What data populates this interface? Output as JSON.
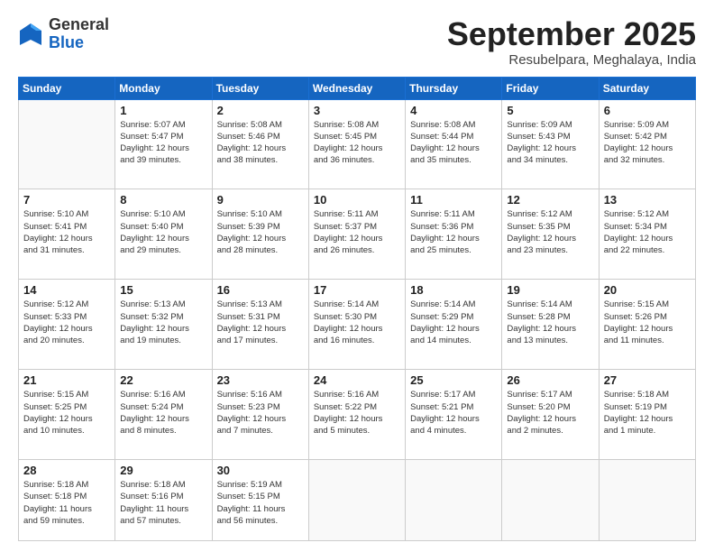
{
  "header": {
    "logo": {
      "line1": "General",
      "line2": "Blue"
    },
    "title": "September 2025",
    "location": "Resubelpara, Meghalaya, India"
  },
  "weekdays": [
    "Sunday",
    "Monday",
    "Tuesday",
    "Wednesday",
    "Thursday",
    "Friday",
    "Saturday"
  ],
  "weeks": [
    [
      {
        "day": null,
        "info": null
      },
      {
        "day": "1",
        "info": "Sunrise: 5:07 AM\nSunset: 5:47 PM\nDaylight: 12 hours\nand 39 minutes."
      },
      {
        "day": "2",
        "info": "Sunrise: 5:08 AM\nSunset: 5:46 PM\nDaylight: 12 hours\nand 38 minutes."
      },
      {
        "day": "3",
        "info": "Sunrise: 5:08 AM\nSunset: 5:45 PM\nDaylight: 12 hours\nand 36 minutes."
      },
      {
        "day": "4",
        "info": "Sunrise: 5:08 AM\nSunset: 5:44 PM\nDaylight: 12 hours\nand 35 minutes."
      },
      {
        "day": "5",
        "info": "Sunrise: 5:09 AM\nSunset: 5:43 PM\nDaylight: 12 hours\nand 34 minutes."
      },
      {
        "day": "6",
        "info": "Sunrise: 5:09 AM\nSunset: 5:42 PM\nDaylight: 12 hours\nand 32 minutes."
      }
    ],
    [
      {
        "day": "7",
        "info": "Sunrise: 5:10 AM\nSunset: 5:41 PM\nDaylight: 12 hours\nand 31 minutes."
      },
      {
        "day": "8",
        "info": "Sunrise: 5:10 AM\nSunset: 5:40 PM\nDaylight: 12 hours\nand 29 minutes."
      },
      {
        "day": "9",
        "info": "Sunrise: 5:10 AM\nSunset: 5:39 PM\nDaylight: 12 hours\nand 28 minutes."
      },
      {
        "day": "10",
        "info": "Sunrise: 5:11 AM\nSunset: 5:37 PM\nDaylight: 12 hours\nand 26 minutes."
      },
      {
        "day": "11",
        "info": "Sunrise: 5:11 AM\nSunset: 5:36 PM\nDaylight: 12 hours\nand 25 minutes."
      },
      {
        "day": "12",
        "info": "Sunrise: 5:12 AM\nSunset: 5:35 PM\nDaylight: 12 hours\nand 23 minutes."
      },
      {
        "day": "13",
        "info": "Sunrise: 5:12 AM\nSunset: 5:34 PM\nDaylight: 12 hours\nand 22 minutes."
      }
    ],
    [
      {
        "day": "14",
        "info": "Sunrise: 5:12 AM\nSunset: 5:33 PM\nDaylight: 12 hours\nand 20 minutes."
      },
      {
        "day": "15",
        "info": "Sunrise: 5:13 AM\nSunset: 5:32 PM\nDaylight: 12 hours\nand 19 minutes."
      },
      {
        "day": "16",
        "info": "Sunrise: 5:13 AM\nSunset: 5:31 PM\nDaylight: 12 hours\nand 17 minutes."
      },
      {
        "day": "17",
        "info": "Sunrise: 5:14 AM\nSunset: 5:30 PM\nDaylight: 12 hours\nand 16 minutes."
      },
      {
        "day": "18",
        "info": "Sunrise: 5:14 AM\nSunset: 5:29 PM\nDaylight: 12 hours\nand 14 minutes."
      },
      {
        "day": "19",
        "info": "Sunrise: 5:14 AM\nSunset: 5:28 PM\nDaylight: 12 hours\nand 13 minutes."
      },
      {
        "day": "20",
        "info": "Sunrise: 5:15 AM\nSunset: 5:26 PM\nDaylight: 12 hours\nand 11 minutes."
      }
    ],
    [
      {
        "day": "21",
        "info": "Sunrise: 5:15 AM\nSunset: 5:25 PM\nDaylight: 12 hours\nand 10 minutes."
      },
      {
        "day": "22",
        "info": "Sunrise: 5:16 AM\nSunset: 5:24 PM\nDaylight: 12 hours\nand 8 minutes."
      },
      {
        "day": "23",
        "info": "Sunrise: 5:16 AM\nSunset: 5:23 PM\nDaylight: 12 hours\nand 7 minutes."
      },
      {
        "day": "24",
        "info": "Sunrise: 5:16 AM\nSunset: 5:22 PM\nDaylight: 12 hours\nand 5 minutes."
      },
      {
        "day": "25",
        "info": "Sunrise: 5:17 AM\nSunset: 5:21 PM\nDaylight: 12 hours\nand 4 minutes."
      },
      {
        "day": "26",
        "info": "Sunrise: 5:17 AM\nSunset: 5:20 PM\nDaylight: 12 hours\nand 2 minutes."
      },
      {
        "day": "27",
        "info": "Sunrise: 5:18 AM\nSunset: 5:19 PM\nDaylight: 12 hours\nand 1 minute."
      }
    ],
    [
      {
        "day": "28",
        "info": "Sunrise: 5:18 AM\nSunset: 5:18 PM\nDaylight: 11 hours\nand 59 minutes."
      },
      {
        "day": "29",
        "info": "Sunrise: 5:18 AM\nSunset: 5:16 PM\nDaylight: 11 hours\nand 57 minutes."
      },
      {
        "day": "30",
        "info": "Sunrise: 5:19 AM\nSunset: 5:15 PM\nDaylight: 11 hours\nand 56 minutes."
      },
      {
        "day": null,
        "info": null
      },
      {
        "day": null,
        "info": null
      },
      {
        "day": null,
        "info": null
      },
      {
        "day": null,
        "info": null
      }
    ]
  ]
}
